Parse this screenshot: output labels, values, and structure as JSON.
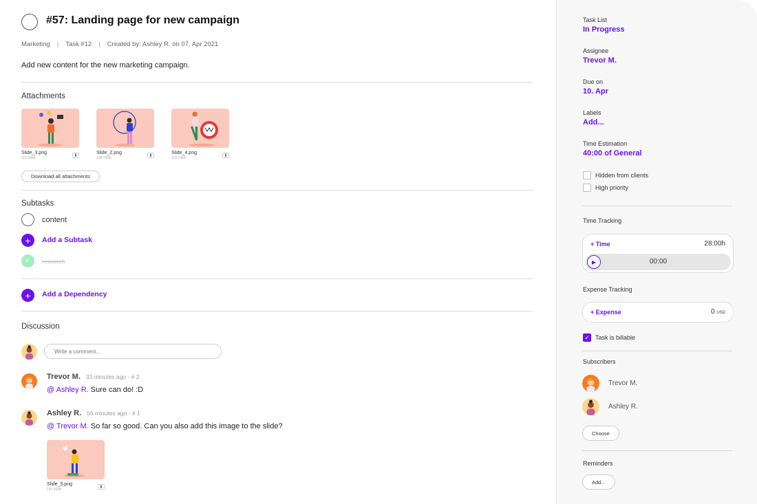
{
  "task": {
    "title": "#57: Landing page for new campaign",
    "project": "Marketing",
    "task_no": "Task #12",
    "created": "Created by: Ashley R. on 07. Apr 2021",
    "separator": "|",
    "description": "Add new content for the new marketing campaign."
  },
  "attachments": {
    "title": "Attachments",
    "items": [
      {
        "name": "Slide_3.png",
        "size": "115.34kB"
      },
      {
        "name": "Slide_2.png",
        "size": "108.79kB"
      },
      {
        "name": "Slide_4.png",
        "size": "118.19kB"
      }
    ],
    "download_all": "Download all attachments"
  },
  "subtasks": {
    "title": "Subtasks",
    "items": [
      {
        "label": "content",
        "status": "open"
      },
      {
        "label": "research",
        "status": "done"
      }
    ],
    "add_label": "Add a Subtask"
  },
  "dependency": {
    "add_label": "Add a Dependency"
  },
  "discussion": {
    "title": "Discussion",
    "input_placeholder": "Write a comment...",
    "comments": [
      {
        "author": "Trevor M.",
        "time": "33 minutes ago - # 2",
        "mention": "@ Ashley R.",
        "text": "Sure can do! :D"
      },
      {
        "author": "Ashley R.",
        "time": "56 minutes ago - # 1",
        "mention": "@ Trevor M.",
        "text": "So far so good. Can you also add this image to the slide?",
        "attachment": {
          "name": "Slide_5.png",
          "size": "131.51kB"
        }
      }
    ]
  },
  "sidebar": {
    "task_list": {
      "label": "Task List",
      "value": "In Progress"
    },
    "assignee": {
      "label": "Assignee",
      "value": "Trevor M."
    },
    "due": {
      "label": "Due on",
      "value": "10. Apr"
    },
    "labels": {
      "label": "Labels",
      "value": "Add..."
    },
    "estimation": {
      "label": "Time Estimation",
      "value": "40:00 of General"
    },
    "hidden_clients": {
      "label": "Hidden from clients",
      "checked": false
    },
    "high_priority": {
      "label": "High priority",
      "checked": false
    },
    "time_tracking": {
      "title": "Time Tracking",
      "add": "+ Time",
      "total": "28:00h",
      "timer": "00:00"
    },
    "expense_tracking": {
      "title": "Expense Tracking",
      "add": "+ Expense",
      "amount": "0",
      "currency": "USD"
    },
    "billable": {
      "label": "Task is billable",
      "checked": true
    },
    "subscribers": {
      "title": "Subscribers",
      "people": [
        "Trevor M.",
        "Ashley R."
      ],
      "choose": "Choose"
    },
    "reminders": {
      "title": "Reminders",
      "add": "Add..."
    }
  },
  "colors": {
    "accent": "#6a11f0",
    "thumb_bg": "#fbc9bd",
    "done_green": "#a6ecbf"
  }
}
